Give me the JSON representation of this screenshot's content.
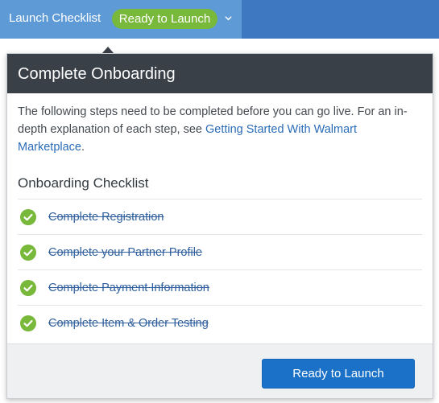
{
  "topbar": {
    "title": "Launch Checklist",
    "status": "Ready to Launch",
    "dropdown_icon": "chevron-down-icon",
    "colors": {
      "bar": "#3e78c0",
      "bar_left": "#5d9ad6",
      "status_pill": "#78b83a"
    }
  },
  "panel": {
    "title": "Complete Onboarding",
    "intro_text": "The following steps need to be completed before you can go live. For an in-depth explanation of each step, see ",
    "intro_link": "Getting Started With Walmart Marketplace",
    "intro_end": ".",
    "section_title": "Onboarding Checklist",
    "items": [
      {
        "label": "Complete Registration",
        "done": true,
        "icon": "check-circle-icon"
      },
      {
        "label": "Complete your Partner Profile",
        "done": true,
        "icon": "check-circle-icon"
      },
      {
        "label": "Complete Payment Information",
        "done": true,
        "icon": "check-circle-icon"
      },
      {
        "label": "Complete Item & Order Testing",
        "done": true,
        "icon": "check-circle-icon"
      }
    ],
    "button_label": "Ready to Launch",
    "colors": {
      "header": "#3a4047",
      "link": "#2b6cb7",
      "check": "#78b83a",
      "button": "#1a71c7"
    }
  }
}
